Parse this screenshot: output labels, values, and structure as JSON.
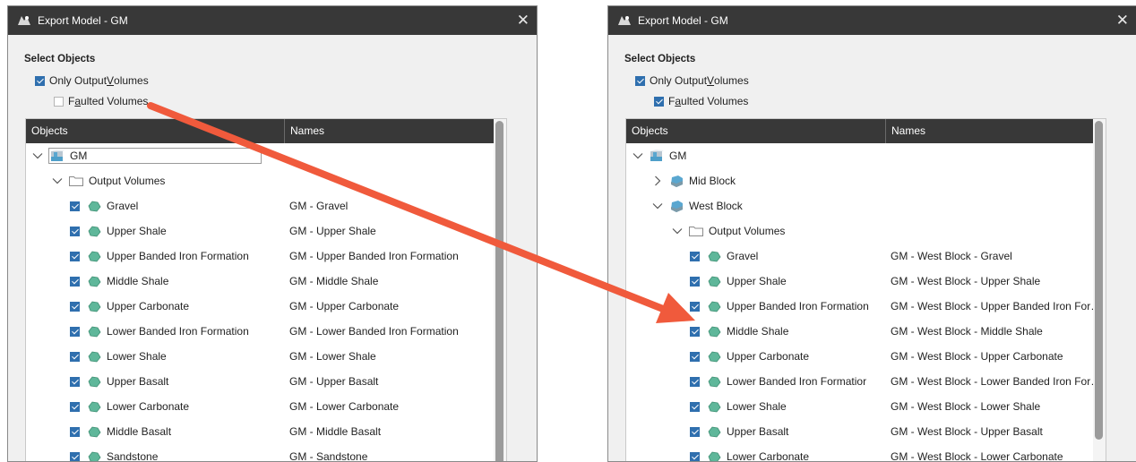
{
  "colors": {
    "titlebar": "#383838",
    "checkbox": "#2f6fae",
    "arrow": "#f05a3c",
    "volume_icon": "#5fb79a",
    "block_icon": "#5aa7d0"
  },
  "dialogs": [
    {
      "title": "Export Model - GM",
      "section": "Select Objects",
      "opt1": {
        "pre": "Only Output ",
        "u": "V",
        "post": "olumes",
        "checked": true
      },
      "opt2": {
        "pre": "F",
        "u": "a",
        "post": "ulted Volumes",
        "checked": false
      },
      "col_objects": "Objects",
      "col_names": "Names",
      "rows": [
        {
          "indent": 0,
          "chev": "down",
          "icon": "model",
          "label": "GM",
          "name": "",
          "checkbox": false,
          "edit": true
        },
        {
          "indent": 1,
          "chev": "down",
          "icon": "folder",
          "label": "Output Volumes",
          "name": "",
          "checkbox": false
        },
        {
          "indent": 2,
          "icon": "volume",
          "label": "Gravel",
          "name": "GM - Gravel",
          "checkbox": true
        },
        {
          "indent": 2,
          "icon": "volume",
          "label": "Upper Shale",
          "name": "GM - Upper Shale",
          "checkbox": true
        },
        {
          "indent": 2,
          "icon": "volume",
          "label": "Upper Banded Iron Formation",
          "name": "GM - Upper Banded Iron Formation",
          "checkbox": true
        },
        {
          "indent": 2,
          "icon": "volume",
          "label": "Middle Shale",
          "name": "GM - Middle Shale",
          "checkbox": true
        },
        {
          "indent": 2,
          "icon": "volume",
          "label": "Upper Carbonate",
          "name": "GM - Upper Carbonate",
          "checkbox": true
        },
        {
          "indent": 2,
          "icon": "volume",
          "label": "Lower Banded Iron Formation",
          "name": "GM - Lower Banded Iron Formation",
          "checkbox": true
        },
        {
          "indent": 2,
          "icon": "volume",
          "label": "Lower Shale",
          "name": "GM - Lower Shale",
          "checkbox": true
        },
        {
          "indent": 2,
          "icon": "volume",
          "label": "Upper Basalt",
          "name": "GM - Upper Basalt",
          "checkbox": true
        },
        {
          "indent": 2,
          "icon": "volume",
          "label": "Lower Carbonate",
          "name": "GM - Lower Carbonate",
          "checkbox": true
        },
        {
          "indent": 2,
          "icon": "volume",
          "label": "Middle Basalt",
          "name": "GM - Middle Basalt",
          "checkbox": true
        },
        {
          "indent": 2,
          "icon": "volume",
          "label": "Sandstone",
          "name": "GM - Sandstone",
          "checkbox": true
        }
      ]
    },
    {
      "title": "Export Model - GM",
      "section": "Select Objects",
      "opt1": {
        "pre": "Only Output ",
        "u": "V",
        "post": "olumes",
        "checked": true
      },
      "opt2": {
        "pre": "F",
        "u": "a",
        "post": "ulted Volumes",
        "checked": true
      },
      "col_objects": "Objects",
      "col_names": "Names",
      "rows": [
        {
          "indent": 0,
          "chev": "down",
          "icon": "model",
          "label": "GM",
          "name": "",
          "checkbox": false
        },
        {
          "indent": 1,
          "chev": "right",
          "icon": "block",
          "label": "Mid Block",
          "name": "",
          "checkbox": false
        },
        {
          "indent": 1,
          "chev": "down",
          "icon": "block",
          "label": "West Block",
          "name": "",
          "checkbox": false
        },
        {
          "indent": 2,
          "chev": "down",
          "icon": "folder",
          "label": "Output Volumes",
          "name": "",
          "checkbox": false
        },
        {
          "indent": 3,
          "icon": "volume",
          "label": "Gravel",
          "name": "GM - West Block - Gravel",
          "checkbox": true
        },
        {
          "indent": 3,
          "icon": "volume",
          "label": "Upper Shale",
          "name": "GM - West Block - Upper Shale",
          "checkbox": true
        },
        {
          "indent": 3,
          "icon": "volume",
          "label": "Upper Banded Iron Formation",
          "name": "GM - West Block - Upper Banded Iron For…",
          "checkbox": true
        },
        {
          "indent": 3,
          "icon": "volume",
          "label": "Middle Shale",
          "name": "GM - West Block - Middle Shale",
          "checkbox": true
        },
        {
          "indent": 3,
          "icon": "volume",
          "label": "Upper Carbonate",
          "name": "GM - West Block - Upper Carbonate",
          "checkbox": true
        },
        {
          "indent": 3,
          "icon": "volume",
          "label": "Lower Banded Iron Formatior",
          "name": "GM - West Block - Lower Banded Iron For…",
          "checkbox": true
        },
        {
          "indent": 3,
          "icon": "volume",
          "label": "Lower Shale",
          "name": "GM - West Block - Lower Shale",
          "checkbox": true
        },
        {
          "indent": 3,
          "icon": "volume",
          "label": "Upper Basalt",
          "name": "GM - West Block - Upper Basalt",
          "checkbox": true
        },
        {
          "indent": 3,
          "icon": "volume",
          "label": "Lower Carbonate",
          "name": "GM - West Block - Lower Carbonate",
          "checkbox": true
        }
      ]
    }
  ]
}
